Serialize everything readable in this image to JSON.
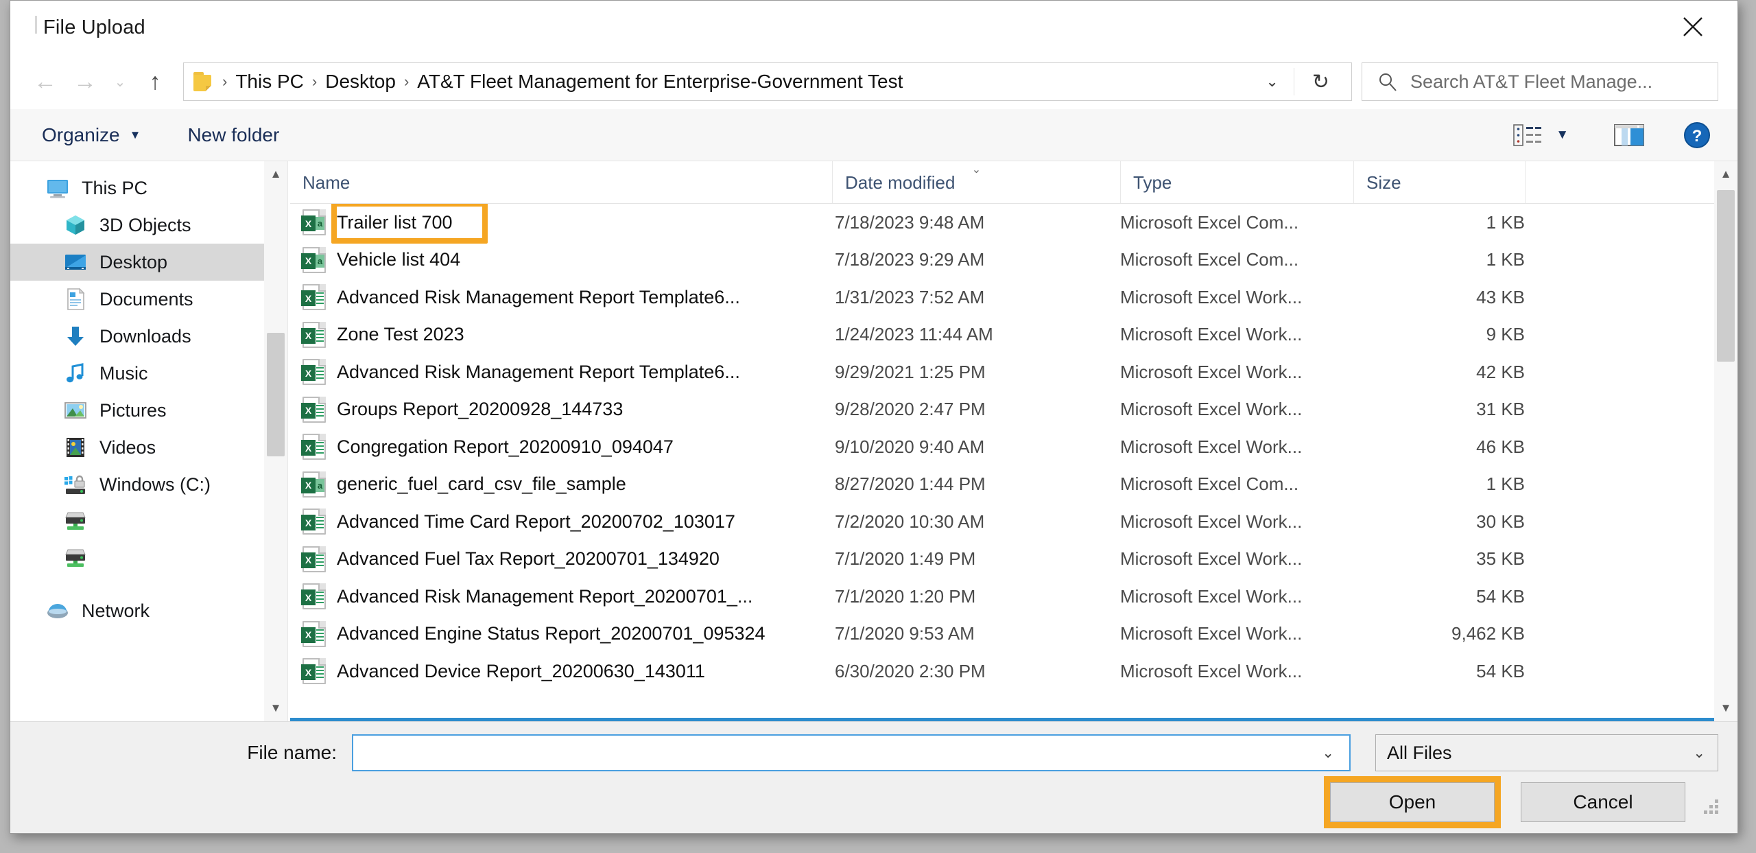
{
  "dialog": {
    "title": "File Upload",
    "close_label": "✕"
  },
  "nav": {
    "back_label": "←",
    "forward_label": "→",
    "recent_label": "⌄",
    "up_label": "↑",
    "address_caret": "⌄",
    "refresh_label": "↻",
    "breadcrumbs": [
      "This PC",
      "Desktop",
      "AT&T Fleet Management for Enterprise-Government Test"
    ],
    "separator": "›"
  },
  "search": {
    "placeholder": "Search AT&T Fleet Manage...",
    "icon": "search-icon"
  },
  "commandbar": {
    "organize_label": "Organize",
    "organize_caret": "▼",
    "new_folder_label": "New folder",
    "view_icon": "list-view-icon",
    "view_caret": "▼",
    "preview_icon": "preview-pane-icon",
    "help_icon": "help-icon",
    "help_label": "?"
  },
  "sidebar": {
    "items": [
      {
        "label": "This PC",
        "icon": "monitor-icon",
        "level": 1,
        "selected": false
      },
      {
        "label": "3D Objects",
        "icon": "cube-icon",
        "level": 2,
        "selected": false
      },
      {
        "label": "Desktop",
        "icon": "desktop-icon",
        "level": 2,
        "selected": true
      },
      {
        "label": "Documents",
        "icon": "document-icon",
        "level": 2,
        "selected": false
      },
      {
        "label": "Downloads",
        "icon": "download-arrow-icon",
        "level": 2,
        "selected": false
      },
      {
        "label": "Music",
        "icon": "music-note-icon",
        "level": 2,
        "selected": false
      },
      {
        "label": "Pictures",
        "icon": "picture-icon",
        "level": 2,
        "selected": false
      },
      {
        "label": "Videos",
        "icon": "film-icon",
        "level": 2,
        "selected": false
      },
      {
        "label": "Windows (C:)",
        "icon": "drive-lock-icon",
        "level": 2,
        "selected": false
      },
      {
        "label": "",
        "icon": "network-drive-icon",
        "level": 2,
        "selected": false
      },
      {
        "label": "",
        "icon": "network-drive-icon",
        "level": 2,
        "selected": false
      },
      {
        "label": "Network",
        "icon": "network-icon",
        "level": 1,
        "selected": false
      }
    ],
    "scroll_up": "▲",
    "scroll_down": "▼"
  },
  "filelist": {
    "columns": [
      "Name",
      "Date modified",
      "Type",
      "Size"
    ],
    "sort_caret": "⌄",
    "sorted_column": "Date modified",
    "rows": [
      {
        "name": "Trailer list 700",
        "date": "7/18/2023 9:48 AM",
        "type": "Microsoft Excel Com...",
        "size": "1 KB",
        "icon": "excel-csv-icon",
        "highlighted": true
      },
      {
        "name": "Vehicle list 404",
        "date": "7/18/2023 9:29 AM",
        "type": "Microsoft Excel Com...",
        "size": "1 KB",
        "icon": "excel-csv-icon",
        "highlighted": false
      },
      {
        "name": "Advanced Risk Management Report Template6...",
        "date": "1/31/2023 7:52 AM",
        "type": "Microsoft Excel Work...",
        "size": "43 KB",
        "icon": "excel-workbook-icon",
        "highlighted": false
      },
      {
        "name": "Zone Test 2023",
        "date": "1/24/2023 11:44 AM",
        "type": "Microsoft Excel Work...",
        "size": "9 KB",
        "icon": "excel-workbook-icon",
        "highlighted": false
      },
      {
        "name": "Advanced Risk Management Report Template6...",
        "date": "9/29/2021 1:25 PM",
        "type": "Microsoft Excel Work...",
        "size": "42 KB",
        "icon": "excel-workbook-icon",
        "highlighted": false
      },
      {
        "name": "Groups Report_20200928_144733",
        "date": "9/28/2020 2:47 PM",
        "type": "Microsoft Excel Work...",
        "size": "31 KB",
        "icon": "excel-workbook-icon",
        "highlighted": false
      },
      {
        "name": "Congregation Report_20200910_094047",
        "date": "9/10/2020 9:40 AM",
        "type": "Microsoft Excel Work...",
        "size": "46 KB",
        "icon": "excel-workbook-icon",
        "highlighted": false
      },
      {
        "name": "generic_fuel_card_csv_file_sample",
        "date": "8/27/2020 1:44 PM",
        "type": "Microsoft Excel Com...",
        "size": "1 KB",
        "icon": "excel-csv-icon",
        "highlighted": false
      },
      {
        "name": "Advanced Time Card Report_20200702_103017",
        "date": "7/2/2020 10:30 AM",
        "type": "Microsoft Excel Work...",
        "size": "30 KB",
        "icon": "excel-workbook-icon",
        "highlighted": false
      },
      {
        "name": "Advanced Fuel Tax Report_20200701_134920",
        "date": "7/1/2020 1:49 PM",
        "type": "Microsoft Excel Work...",
        "size": "35 KB",
        "icon": "excel-workbook-icon",
        "highlighted": false
      },
      {
        "name": "Advanced Risk Management Report_20200701_...",
        "date": "7/1/2020 1:20 PM",
        "type": "Microsoft Excel Work...",
        "size": "54 KB",
        "icon": "excel-workbook-icon",
        "highlighted": false
      },
      {
        "name": "Advanced Engine Status Report_20200701_095324",
        "date": "7/1/2020 9:53 AM",
        "type": "Microsoft Excel Work...",
        "size": "9,462 KB",
        "icon": "excel-workbook-icon",
        "highlighted": false
      },
      {
        "name": "Advanced Device Report_20200630_143011",
        "date": "6/30/2020 2:30 PM",
        "type": "Microsoft Excel Work...",
        "size": "54 KB",
        "icon": "excel-workbook-icon",
        "highlighted": false
      }
    ]
  },
  "footer": {
    "filename_label": "File name:",
    "filename_value": "",
    "filename_caret": "⌄",
    "filter_value": "All Files",
    "filter_caret": "⌄",
    "open_label": "Open",
    "cancel_label": "Cancel"
  },
  "colors": {
    "highlight": "#F5A623",
    "selection": "#d8d8d8",
    "focus_border": "#4a9fe0",
    "accent_blue": "#2d8ccd",
    "excel_green": "#1d7044"
  }
}
